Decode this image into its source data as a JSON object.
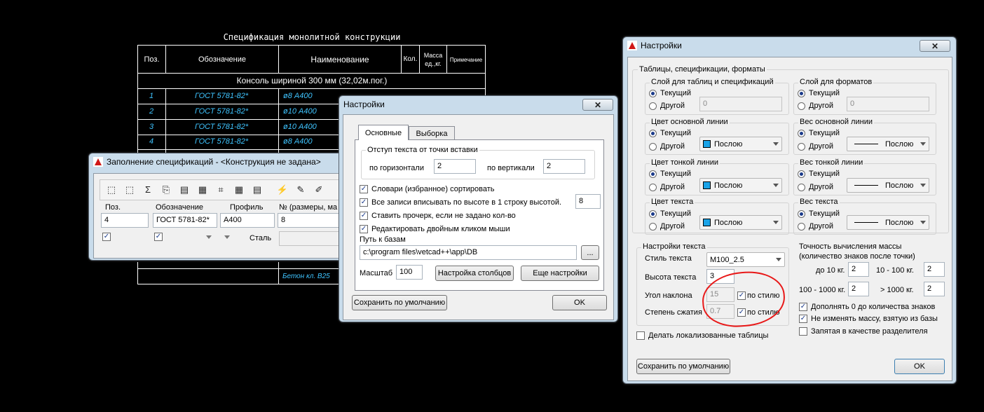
{
  "cad": {
    "title": "Спецификация монолитной конструкции",
    "headers": [
      "Поз.",
      "Обозначение",
      "Наименование",
      "Кол.",
      "Масса ед.,кг.",
      "Примечание"
    ],
    "group_row": "Консоль шириной 300 мм (32,02м.пог.)",
    "rows": [
      {
        "pos": "1",
        "designation": "ГОСТ 5781-82*",
        "name": "ø8 А400"
      },
      {
        "pos": "2",
        "designation": "ГОСТ 5781-82*",
        "name": "ø10 А400"
      },
      {
        "pos": "3",
        "designation": "ГОСТ 5781-82*",
        "name": "ø10 А400"
      },
      {
        "pos": "4",
        "designation": "ГОСТ 5781-82*",
        "name": "ø8 А400"
      }
    ],
    "footer_cell": "Бетон кл. В25"
  },
  "fill_window": {
    "title": "Заполнение спецификаций - <Конструкция не задана>",
    "columns": [
      "Поз.",
      "Обозначение",
      "Профиль",
      "№ (размеры, ма"
    ],
    "values": {
      "pos": "4",
      "designation": "ГОСТ 5781-82*",
      "profile": "A400",
      "number": "8"
    },
    "material_label": "Сталь"
  },
  "settings_small": {
    "title": "Настройки",
    "tabs": [
      "Основные",
      "Выборка"
    ],
    "offset_group": "Отступ текста от точки вставки",
    "horiz_label": "по горизонтали",
    "horiz_value": "2",
    "vert_label": "по вертикали",
    "vert_value": "2",
    "checks": [
      "Словари (избранное) сортировать",
      "Все записи вписывать по высоте в 1 строку высотой.",
      "Ставить прочерк, если не задано кол-во",
      "Редактировать двойным кликом мыши"
    ],
    "row_height_value": "8",
    "path_label": "Путь к базам",
    "path_value": "c:\\program files\\vetcad++\\app\\DB",
    "browse_label": "...",
    "scale_label": "Масштаб",
    "scale_value": "100",
    "columns_btn": "Настройка столбцов",
    "more_btn": "Еще настройки",
    "save_default_btn": "Сохранить по умолчанию",
    "ok_btn": "OK"
  },
  "settings_big": {
    "title": "Настройки",
    "outer_group": "Таблицы, спецификации, форматы",
    "layer_tables": {
      "title": "Слой для таблиц и спецификаций",
      "current": "Текущий",
      "other": "Другой",
      "value": "0"
    },
    "layer_formats": {
      "title": "Слой для форматов",
      "current": "Текущий",
      "other": "Другой",
      "value": "0"
    },
    "main_line_color": {
      "title": "Цвет основной линии",
      "current": "Текущий",
      "other": "Другой",
      "value": "Послою"
    },
    "main_line_weight": {
      "title": "Вес основной линии",
      "current": "Текущий",
      "other": "Другой",
      "value": "Послою"
    },
    "thin_line_color": {
      "title": "Цвет тонкой линии",
      "current": "Текущий",
      "other": "Другой",
      "value": "Послою"
    },
    "thin_line_weight": {
      "title": "Вес тонкой линии",
      "current": "Текущий",
      "other": "Другой",
      "value": "Послою"
    },
    "text_color": {
      "title": "Цвет текста",
      "current": "Текущий",
      "other": "Другой",
      "value": "Послою"
    },
    "text_weight": {
      "title": "Вес текста",
      "current": "Текущий",
      "other": "Другой",
      "value": "Послою"
    },
    "text_settings": {
      "title": "Настройки текста",
      "style_label": "Стиль текста",
      "style_value": "M100_2.5",
      "height_label": "Высота текста",
      "height_value": "3",
      "angle_label": "Угол наклона",
      "angle_value": "15",
      "angle_by_style": "по стилю",
      "ratio_label": "Степень сжатия",
      "ratio_value": "0.7",
      "ratio_by_style": "по стилю"
    },
    "mass_precision": {
      "title": "Точность вычисления массы",
      "subtitle": "(количество знаков после точки)",
      "r1_label": "до 10 кг.",
      "r1_value": "2",
      "r2_label": "10 - 100 кг.",
      "r2_value": "2",
      "r3_label": "100 - 1000 кг.",
      "r3_value": "2",
      "r4_label": "> 1000 кг.",
      "r4_value": "2",
      "chk1": "Дополнять 0 до количества знаков",
      "chk2": "Не изменять массу, взятую из базы",
      "chk3": "Запятая в качестве разделителя"
    },
    "localized_tables": "Делать локализованные таблицы",
    "save_default_btn": "Сохранить по умолчанию",
    "ok_btn": "OK"
  },
  "colors": {
    "cad_cyan": "#3fc4ff",
    "swatch_blue": "#1aa3e8",
    "annotation_red": "#e81818"
  }
}
